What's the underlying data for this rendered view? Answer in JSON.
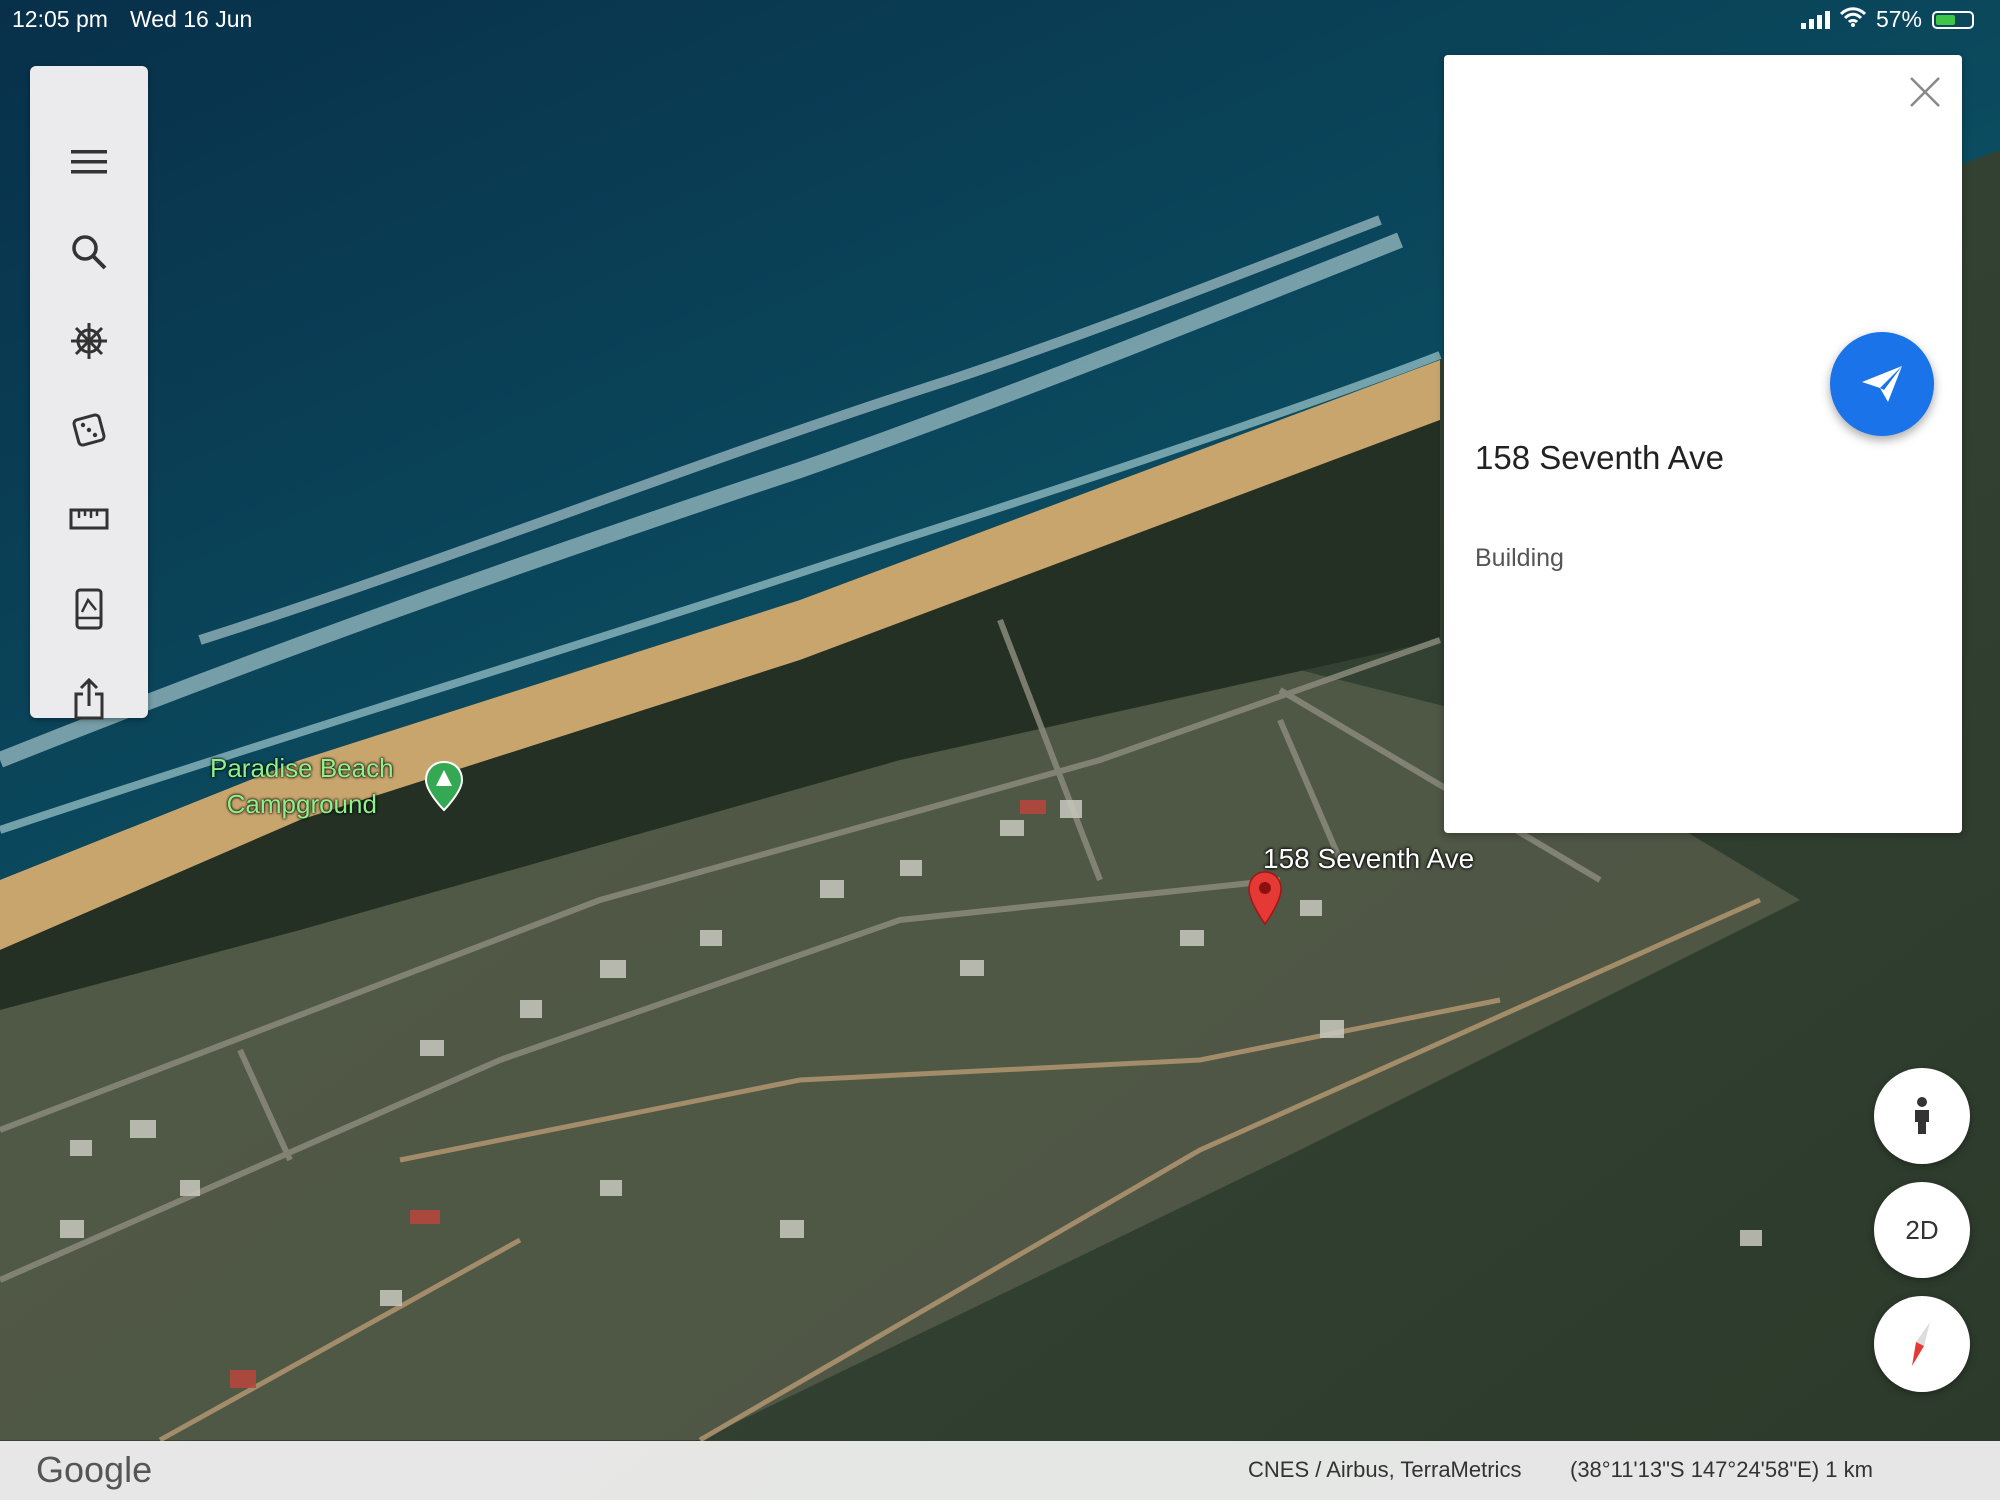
{
  "status_bar": {
    "time": "12:05 pm",
    "date": "Wed 16 Jun",
    "battery": "57%",
    "battery_level": 0.57
  },
  "toolbar": {
    "items": [
      {
        "icon": "menu-icon"
      },
      {
        "icon": "search-icon"
      },
      {
        "icon": "voyager-icon"
      },
      {
        "icon": "feeling-lucky-icon"
      },
      {
        "icon": "measure-icon"
      },
      {
        "icon": "map-style-icon"
      },
      {
        "icon": "share-icon"
      }
    ]
  },
  "place_card": {
    "title": "158 Seventh Ave",
    "subtitle": "Building",
    "accent": "#1a73e8"
  },
  "map": {
    "pin_label": "158 Seventh Ave",
    "poi_line1": "Paradise Beach",
    "poi_line2": "Campground",
    "pin_color": "#e53935",
    "poi_color": "#34a853"
  },
  "controls": {
    "view_mode": "2D"
  },
  "bottom_bar": {
    "logo": "Google",
    "attribution": "CNES / Airbus, TerraMetrics",
    "coordinates": "(38°11'13\"S 147°24'58\"E) 1 km"
  }
}
